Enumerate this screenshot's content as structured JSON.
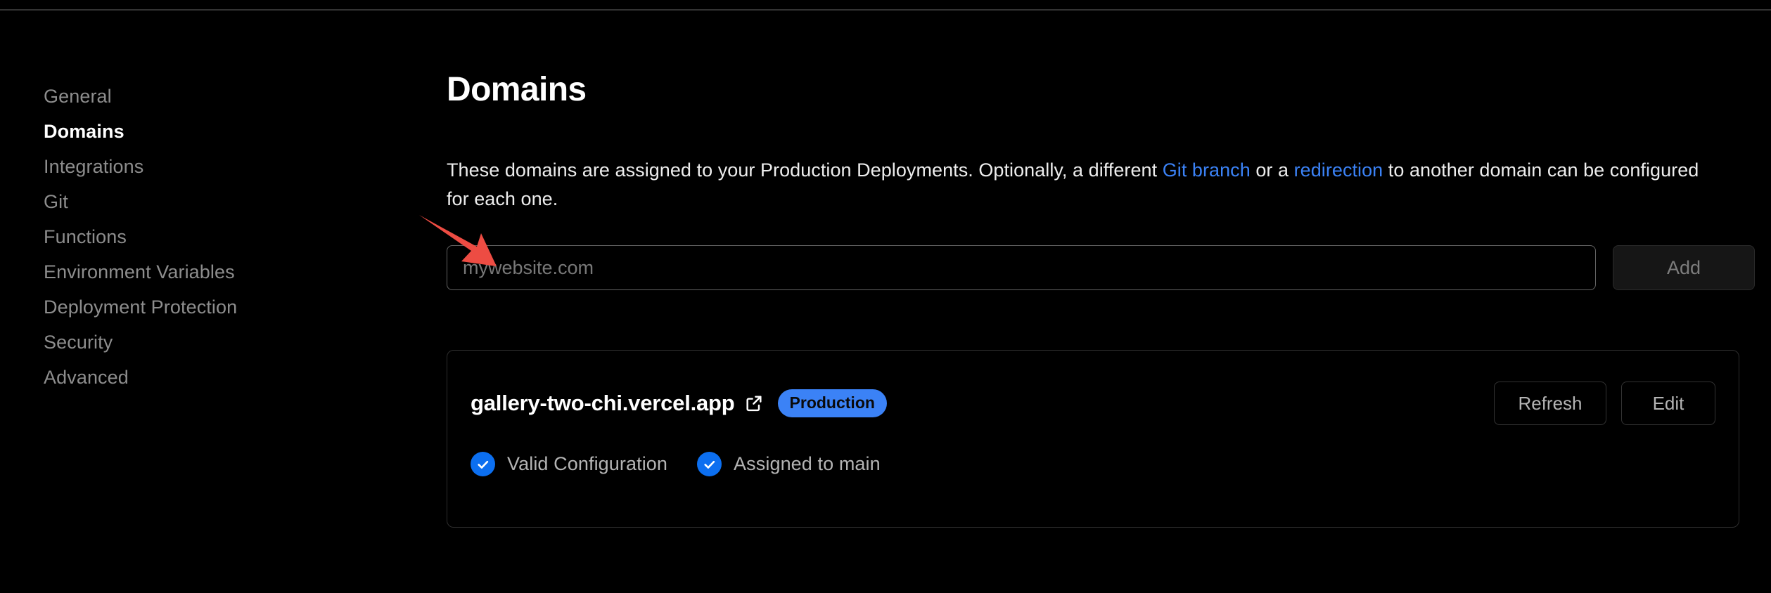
{
  "sidebar": {
    "items": [
      {
        "label": "General",
        "active": false
      },
      {
        "label": "Domains",
        "active": true
      },
      {
        "label": "Integrations",
        "active": false
      },
      {
        "label": "Git",
        "active": false
      },
      {
        "label": "Functions",
        "active": false
      },
      {
        "label": "Environment Variables",
        "active": false
      },
      {
        "label": "Deployment Protection",
        "active": false
      },
      {
        "label": "Security",
        "active": false
      },
      {
        "label": "Advanced",
        "active": false
      }
    ]
  },
  "main": {
    "title": "Domains",
    "description": {
      "part1": "These domains are assigned to your Production Deployments. Optionally, a different ",
      "link1": "Git branch",
      "part2": " or a ",
      "link2": "redirection",
      "part3": " to another domain can be configured for each one."
    },
    "add_domain": {
      "input_placeholder": "mywebsite.com",
      "input_value": "",
      "add_label": "Add"
    },
    "domain_card": {
      "name": "gallery-two-chi.vercel.app",
      "external_link_icon": "external-link-icon",
      "badge": "Production",
      "refresh_label": "Refresh",
      "edit_label": "Edit",
      "statuses": [
        {
          "icon": "check-icon",
          "label": "Valid Configuration"
        },
        {
          "icon": "check-icon",
          "label": "Assigned to main"
        }
      ]
    }
  },
  "annotation": {
    "arrow_color": "#ed4c43",
    "target": "domain-input"
  },
  "colors": {
    "background": "#000000",
    "accent_blue": "#3b82f6",
    "check_blue": "#0c6ff0",
    "muted_text": "#8d8d8d",
    "border": "#2e2e2e",
    "annotation_red": "#ed4c43"
  }
}
